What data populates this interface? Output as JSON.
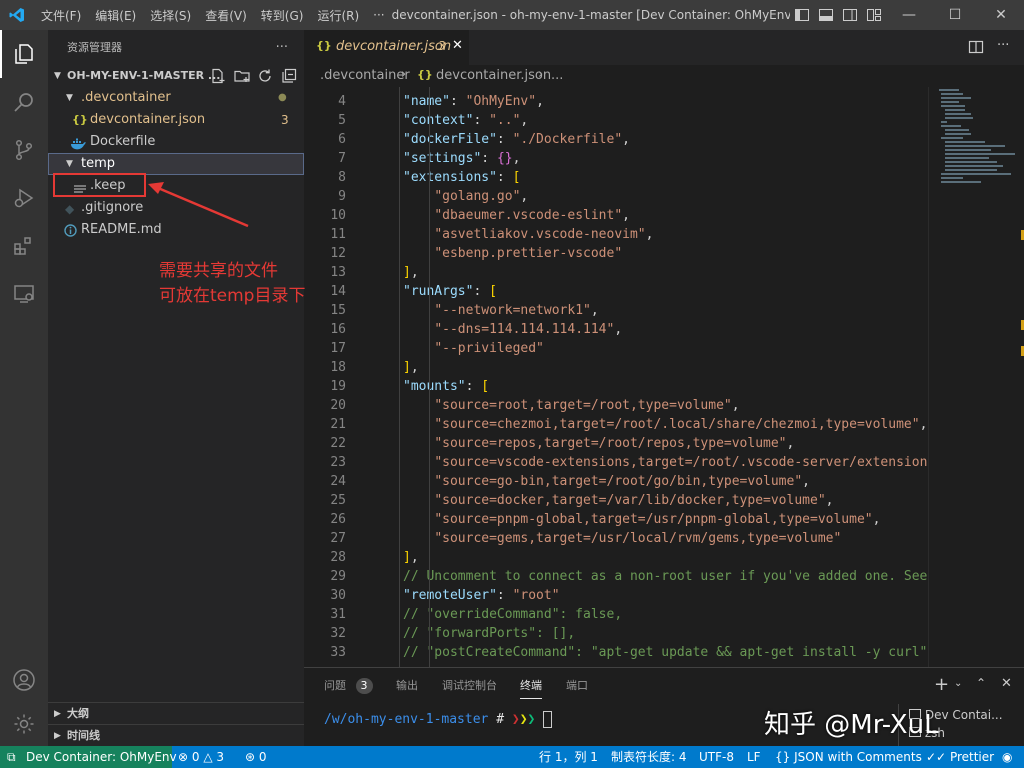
{
  "titlebar": {
    "menus": [
      "文件(F)",
      "编辑(E)",
      "选择(S)",
      "查看(V)",
      "转到(G)",
      "运行(R)",
      "···"
    ],
    "window_title": "devcontainer.json - oh-my-env-1-master [Dev Container: OhMyEnv..."
  },
  "sidebar": {
    "title": "资源管理器",
    "more": "···",
    "folder": "OH-MY-ENV-1-MASTER ...",
    "tree": [
      {
        "label": ".devcontainer",
        "badge": "●"
      },
      {
        "label": "devcontainer.json",
        "badge": "3"
      },
      {
        "label": "Dockerfile"
      },
      {
        "label": "temp"
      },
      {
        "label": ".keep"
      },
      {
        "label": ".gitignore"
      },
      {
        "label": "README.md"
      }
    ],
    "annotation_line1": "需要共享的文件",
    "annotation_line2": "可放在temp目录下",
    "outline": "大纲",
    "timeline": "时间线"
  },
  "tab": {
    "name": "devcontainer.json",
    "badge": "3"
  },
  "breadcrumb": {
    "part1": ".devcontainer",
    "part2": "devcontainer.json",
    "part3": "..."
  },
  "code": {
    "lines": [
      {
        "n": "4",
        "t": "\"name\": \"OhMyEnv\","
      },
      {
        "n": "5",
        "t": "\"context\": \"..\","
      },
      {
        "n": "6",
        "t": "\"dockerFile\": \"./Dockerfile\","
      },
      {
        "n": "7",
        "t": "\"settings\": {},"
      },
      {
        "n": "8",
        "t": "\"extensions\": ["
      },
      {
        "n": "9",
        "t": "    \"golang.go\","
      },
      {
        "n": "10",
        "t": "    \"dbaeumer.vscode-eslint\","
      },
      {
        "n": "11",
        "t": "    \"asvetliakov.vscode-neovim\","
      },
      {
        "n": "12",
        "t": "    \"esbenp.prettier-vscode\""
      },
      {
        "n": "13",
        "t": "],"
      },
      {
        "n": "14",
        "t": "\"runArgs\": ["
      },
      {
        "n": "15",
        "t": "    \"--network=network1\","
      },
      {
        "n": "16",
        "t": "    \"--dns=114.114.114.114\","
      },
      {
        "n": "17",
        "t": "    \"--privileged\""
      },
      {
        "n": "18",
        "t": "],"
      },
      {
        "n": "19",
        "t": "\"mounts\": ["
      },
      {
        "n": "20",
        "t": "    \"source=root,target=/root,type=volume\","
      },
      {
        "n": "21",
        "t": "    \"source=chezmoi,target=/root/.local/share/chezmoi,type=volume\","
      },
      {
        "n": "22",
        "t": "    \"source=repos,target=/root/repos,type=volume\","
      },
      {
        "n": "23",
        "t": "    \"source=vscode-extensions,target=/root/.vscode-server/extensions"
      },
      {
        "n": "24",
        "t": "    \"source=go-bin,target=/root/go/bin,type=volume\","
      },
      {
        "n": "25",
        "t": "    \"source=docker,target=/var/lib/docker,type=volume\","
      },
      {
        "n": "26",
        "t": "    \"source=pnpm-global,target=/usr/pnpm-global,type=volume\","
      },
      {
        "n": "27",
        "t": "    \"source=gems,target=/usr/local/rvm/gems,type=volume\""
      },
      {
        "n": "28",
        "t": "],"
      },
      {
        "n": "29",
        "t": "// Uncomment to connect as a non-root user if you've added one. See"
      },
      {
        "n": "30",
        "t": "\"remoteUser\": \"root\""
      },
      {
        "n": "31",
        "t": "// \"overrideCommand\": false,"
      },
      {
        "n": "32",
        "t": "// \"forwardPorts\": [],"
      },
      {
        "n": "33",
        "t": "// \"postCreateCommand\": \"apt-get update && apt-get install -y curl\","
      }
    ]
  },
  "panel": {
    "tabs": [
      "问题",
      "输出",
      "调试控制台",
      "终端",
      "端口"
    ],
    "problems_badge": "3",
    "prompt_path": "/w/oh-my-env-1-master",
    "prompt_symbol": "#",
    "terminals": [
      "Dev Contai...",
      "zsh"
    ],
    "add": "+"
  },
  "watermark": "知乎 @Mr-XuL",
  "status": {
    "remote": "Dev Container: OhMyEnv",
    "errors": "0",
    "warnings": "3",
    "ports": "0",
    "position": "行 1，列 1",
    "tabsize": "制表符长度: 4",
    "encoding": "UTF-8",
    "eol": "LF",
    "language": "JSON with Comments",
    "formatter": "Prettier"
  },
  "colors": {
    "accent": "#007acc",
    "annotation": "#e53935",
    "selection": "#37373d"
  }
}
